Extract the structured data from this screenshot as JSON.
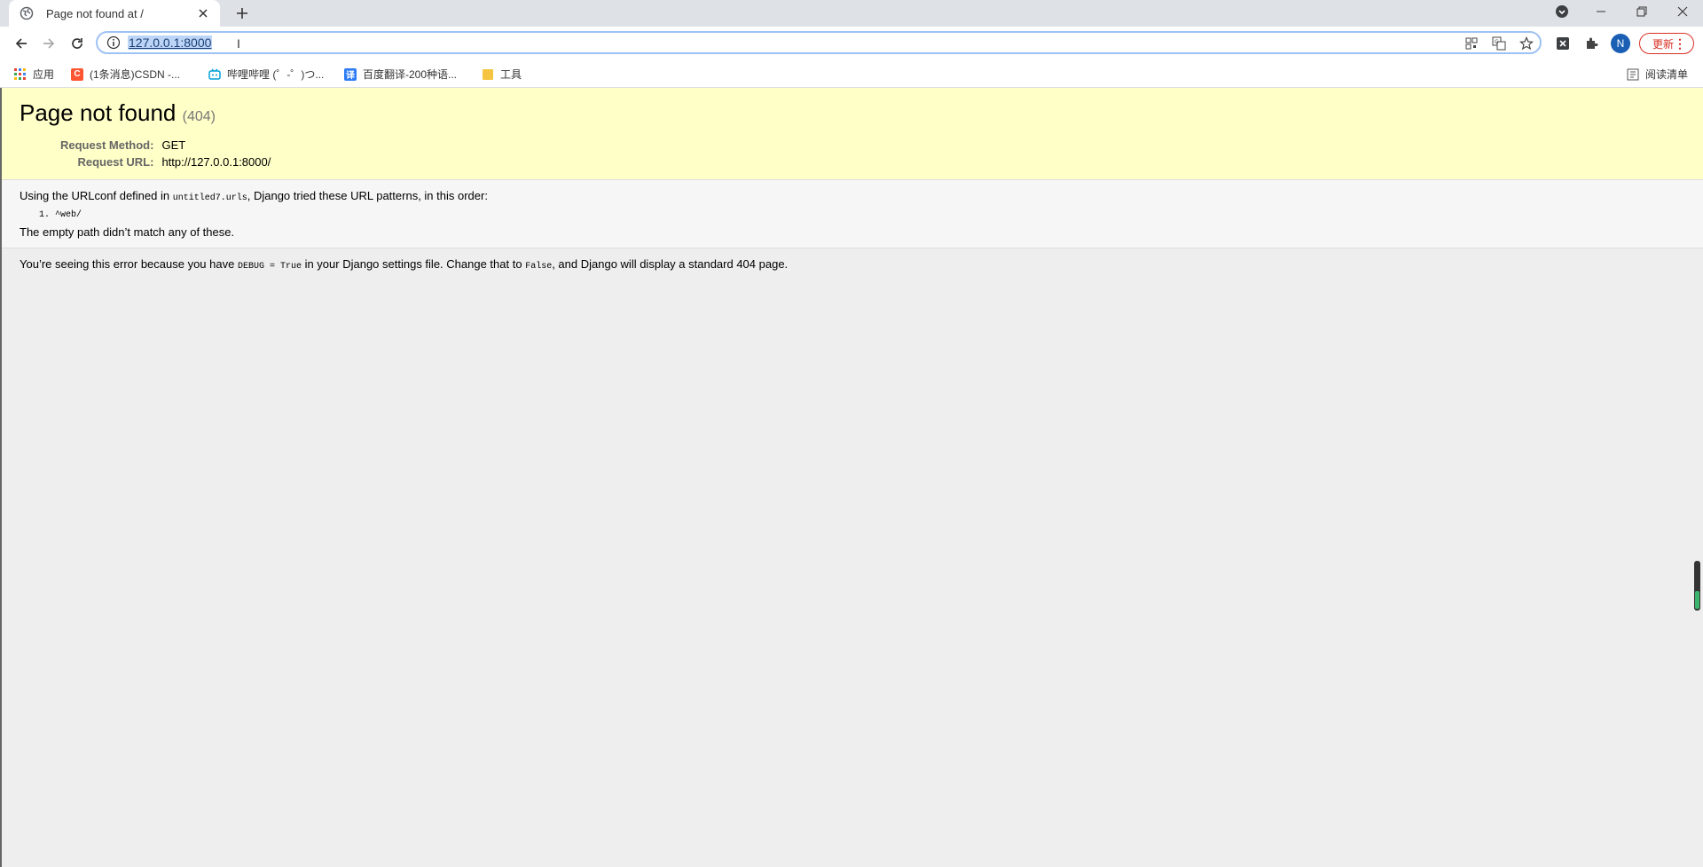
{
  "browser": {
    "tab": {
      "title": "Page not found at /"
    },
    "address_bar": {
      "url": "127.0.0.1:8000"
    },
    "update_button": {
      "label": "更新"
    },
    "avatar_letter": "N",
    "bookmarks": [
      {
        "label": "应用",
        "icon": "apps-grid-icon"
      },
      {
        "label": "(1条消息)CSDN -...",
        "icon": "csdn-icon"
      },
      {
        "label": "哔哩哔哩 (゜-゜)つ...",
        "icon": "bilibili-icon"
      },
      {
        "label": "百度翻译-200种语...",
        "icon": "baidu-translate-icon"
      },
      {
        "label": "工具",
        "icon": "folder-icon"
      }
    ],
    "reading_list": {
      "label": "阅读清单"
    }
  },
  "page": {
    "title": "Page not found",
    "status": "(404)",
    "request_method_label": "Request Method:",
    "request_method": "GET",
    "request_url_label": "Request URL:",
    "request_url": "http://127.0.0.1:8000/",
    "info": {
      "prefix": "Using the URLconf defined in ",
      "urlconf": "untitled7.urls",
      "suffix": ", Django tried these URL patterns, in this order:",
      "patterns": [
        "^web/"
      ],
      "no_match": "The empty path didn’t match any of these."
    },
    "explanation": {
      "part1": "You’re seeing this error because you have ",
      "debug_code": "DEBUG = True",
      "part2": " in your Django settings file. Change that to ",
      "false_code": "False",
      "part3": ", and Django will display a standard 404 page."
    }
  },
  "colors": {
    "summary_bg": "#ffffc8",
    "info_bg": "#f6f6f6",
    "url_highlight": "#bcd5f7",
    "update_red": "#d93025"
  }
}
